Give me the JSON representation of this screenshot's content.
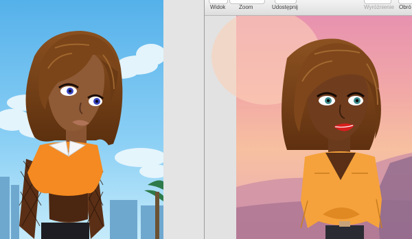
{
  "colors": {
    "sky_left": "#6cc1ef",
    "sunset_top": "#e8a0b2",
    "sunset_mid": "#f4b79c",
    "toolbar_bg": "#e6e6e6",
    "orange_top": "#f48a21",
    "hair_brown": "#7b4519"
  },
  "toolbar": {
    "items": [
      {
        "label": "Widok",
        "enabled": true,
        "icon": "view-icon"
      },
      {
        "label": "Zoom",
        "enabled": true,
        "icon": "zoom-icon"
      },
      {
        "label": "Udostępnij",
        "enabled": true,
        "icon": "share-icon"
      },
      {
        "label": "Wyróżnienie",
        "enabled": false,
        "icon": "highlight-icon"
      },
      {
        "label": "Obró",
        "enabled": true,
        "icon": "rotate-icon"
      }
    ]
  }
}
